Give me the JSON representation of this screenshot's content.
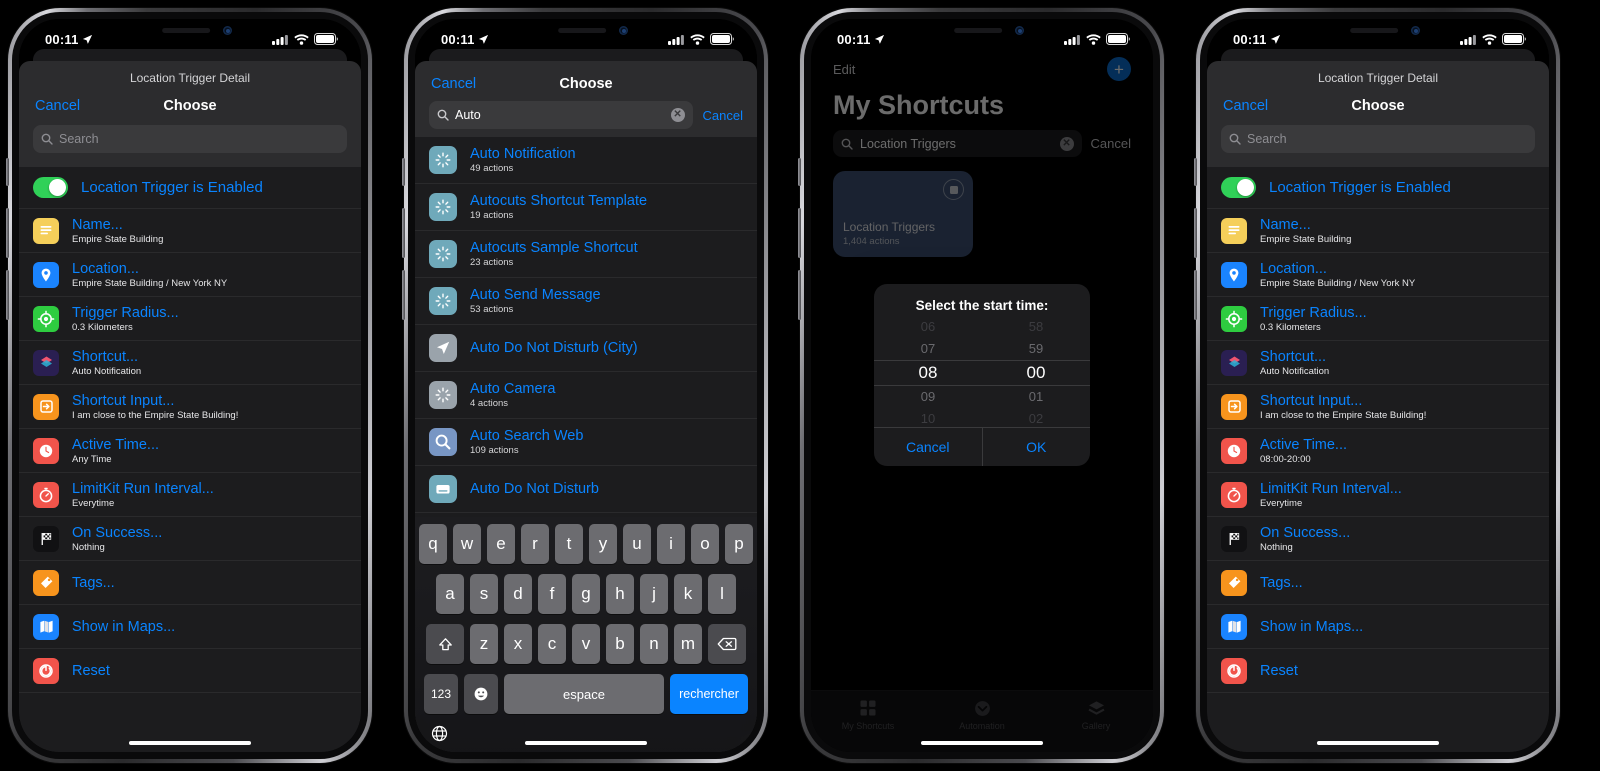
{
  "status_bar": {
    "time": "00:11",
    "location_icon": "location-arrow-icon",
    "cellular_icon": "cellular-bars-icon",
    "wifi_icon": "wifi-icon",
    "battery_icon": "battery-icon"
  },
  "phone1": {
    "sheet_title": "Location Trigger Detail",
    "nav": {
      "cancel": "Cancel",
      "title": "Choose"
    },
    "search": {
      "placeholder": "Search",
      "value": ""
    },
    "toggle": {
      "label": "Location Trigger is Enabled",
      "state": "on"
    },
    "rows": [
      {
        "icon": "note-text-icon",
        "title": "Name...",
        "sub": "Empire State Building"
      },
      {
        "icon": "map-pin-icon",
        "title": "Location...",
        "sub": "Empire State Building / New York NY"
      },
      {
        "icon": "target-crosshair-icon",
        "title": "Trigger Radius...",
        "sub": "0.3 Kilometers"
      },
      {
        "icon": "shortcuts-layers-icon",
        "title": "Shortcut...",
        "sub": "Auto Notification"
      },
      {
        "icon": "input-arrow-icon",
        "title": "Shortcut Input...",
        "sub": "I am close to the Empire State Building!"
      },
      {
        "icon": "clock-icon",
        "title": "Active Time...",
        "sub": "Any Time"
      },
      {
        "icon": "stopwatch-icon",
        "title": "LimitKit Run Interval...",
        "sub": "Everytime"
      },
      {
        "icon": "checkered-flag-icon",
        "title": "On Success...",
        "sub": "Nothing"
      },
      {
        "icon": "tag-icon",
        "title": "Tags...",
        "sub": ""
      },
      {
        "icon": "map-fold-icon",
        "title": "Show in Maps...",
        "sub": ""
      },
      {
        "icon": "reset-power-icon",
        "title": "Reset",
        "sub": ""
      }
    ]
  },
  "phone2": {
    "nav": {
      "cancel": "Cancel",
      "title": "Choose"
    },
    "search": {
      "value": "Auto",
      "placeholder": "Search",
      "cancel": "Cancel",
      "clear_icon": "clear-circle-icon"
    },
    "results": [
      {
        "icon": "sparkle-burst-icon",
        "title": "Auto Notification",
        "sub": "49 actions"
      },
      {
        "icon": "sparkle-burst-icon",
        "title": "Autocuts Shortcut Template",
        "sub": "19 actions"
      },
      {
        "icon": "sparkle-burst-icon",
        "title": "Autocuts Sample Shortcut",
        "sub": "23 actions"
      },
      {
        "icon": "sparkle-burst-icon",
        "title": "Auto Send Message",
        "sub": "53 actions"
      },
      {
        "icon": "navigation-arrow-icon",
        "title": "Auto Do Not Disturb (City)",
        "sub": ""
      },
      {
        "icon": "sparkle-burst-icon",
        "title": "Auto Camera",
        "sub": "4 actions"
      },
      {
        "icon": "magnifier-icon",
        "title": "Auto Search Web",
        "sub": "109 actions"
      },
      {
        "icon": "moon-tablet-icon",
        "title": "Auto Do Not Disturb",
        "sub": ""
      }
    ],
    "keyboard": {
      "row1": [
        "q",
        "w",
        "e",
        "r",
        "t",
        "y",
        "u",
        "i",
        "o",
        "p"
      ],
      "row2": [
        "a",
        "s",
        "d",
        "f",
        "g",
        "h",
        "j",
        "k",
        "l"
      ],
      "row3": [
        "z",
        "x",
        "c",
        "v",
        "b",
        "n",
        "m"
      ],
      "shift_icon": "shift-up-icon",
      "backspace_icon": "backspace-icon",
      "numbers_key": "123",
      "emoji_icon": "emoji-smiley-icon",
      "space_key": "espace",
      "return_key": "rechercher",
      "globe_icon": "globe-icon"
    }
  },
  "phone3": {
    "edit": "Edit",
    "add_icon": "plus-circle-icon",
    "title": "My Shortcuts",
    "search": {
      "value": "Location Triggers",
      "cancel": "Cancel",
      "clear_icon": "clear-circle-icon",
      "search_icon": "search-icon"
    },
    "card": {
      "name": "Location Triggers",
      "sub": "1,404 actions",
      "run_icon": "run-stop-icon"
    },
    "alert": {
      "title": "Select the start time:",
      "hours": [
        "06",
        "07",
        "08",
        "09",
        "10"
      ],
      "minutes": [
        "58",
        "59",
        "00",
        "01",
        "02"
      ],
      "selected_hour": "08",
      "selected_minute": "00",
      "cancel": "Cancel",
      "ok": "OK"
    },
    "tabs": [
      {
        "icon": "grid-squares-icon",
        "label": "My Shortcuts"
      },
      {
        "icon": "automation-clock-icon",
        "label": "Automation"
      },
      {
        "icon": "layers-icon",
        "label": "Gallery"
      }
    ]
  },
  "phone4": {
    "sheet_title": "Location Trigger Detail",
    "nav": {
      "cancel": "Cancel",
      "title": "Choose"
    },
    "search": {
      "placeholder": "Search",
      "value": ""
    },
    "toggle": {
      "label": "Location Trigger is Enabled",
      "state": "on"
    },
    "rows": [
      {
        "icon": "note-text-icon",
        "title": "Name...",
        "sub": "Empire State Building"
      },
      {
        "icon": "map-pin-icon",
        "title": "Location...",
        "sub": "Empire State Building / New York NY"
      },
      {
        "icon": "target-crosshair-icon",
        "title": "Trigger Radius...",
        "sub": "0.3 Kilometers"
      },
      {
        "icon": "shortcuts-layers-icon",
        "title": "Shortcut...",
        "sub": "Auto Notification"
      },
      {
        "icon": "input-arrow-icon",
        "title": "Shortcut Input...",
        "sub": "I am close to the Empire State Building!"
      },
      {
        "icon": "clock-icon",
        "title": "Active Time...",
        "sub": "08:00-20:00"
      },
      {
        "icon": "stopwatch-icon",
        "title": "LimitKit Run Interval...",
        "sub": "Everytime"
      },
      {
        "icon": "checkered-flag-icon",
        "title": "On Success...",
        "sub": "Nothing"
      },
      {
        "icon": "tag-icon",
        "title": "Tags...",
        "sub": ""
      },
      {
        "icon": "map-fold-icon",
        "title": "Show in Maps...",
        "sub": ""
      },
      {
        "icon": "reset-power-icon",
        "title": "Reset",
        "sub": ""
      }
    ]
  },
  "colors": {
    "accent_blue": "#0a84ff",
    "toggle_green": "#30d158",
    "icon_yellow": "#f5cf5a",
    "icon_blue": "#1a84ff",
    "icon_green": "#2ecc40",
    "icon_orange": "#f7941d",
    "icon_red": "#f1544b",
    "icon_black": "#111113",
    "card_blue": "#3d5274",
    "shortcut_teal": "#6fa9ba"
  }
}
